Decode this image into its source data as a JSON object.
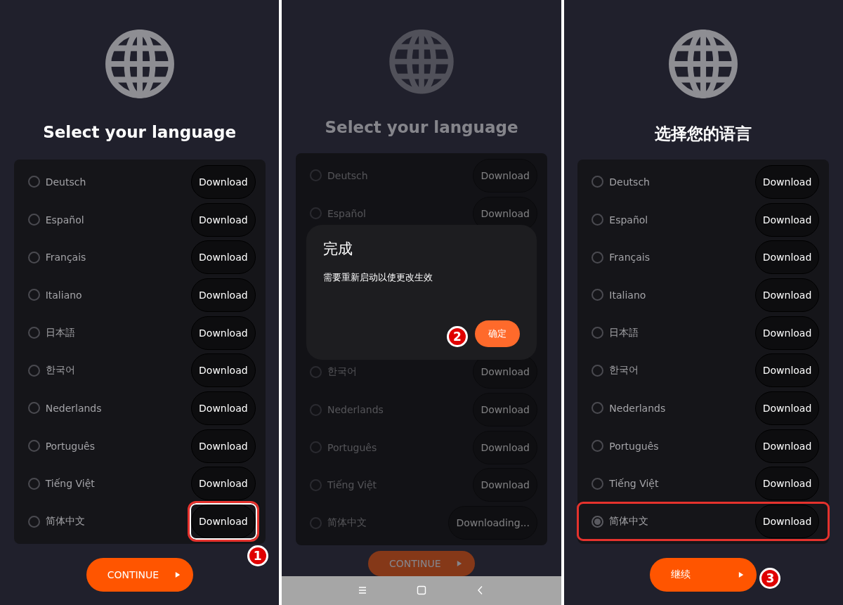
{
  "panels": [
    {
      "title": "Select your language",
      "dimmed": false,
      "nav_bar": false,
      "continue": {
        "label": "CONTINUE"
      },
      "items": [
        {
          "kind": "language",
          "name": "Deutsch",
          "selected": false,
          "button": "Download",
          "row_highlighted": false,
          "button_highlighted": false
        },
        {
          "kind": "language",
          "name": "Español",
          "selected": false,
          "button": "Download",
          "row_highlighted": false,
          "button_highlighted": false
        },
        {
          "kind": "language",
          "name": "Français",
          "selected": false,
          "button": "Download",
          "row_highlighted": false,
          "button_highlighted": false
        },
        {
          "kind": "language",
          "name": "Italiano",
          "selected": false,
          "button": "Download",
          "row_highlighted": false,
          "button_highlighted": false
        },
        {
          "kind": "language",
          "name": "日本語",
          "selected": false,
          "button": "Download",
          "row_highlighted": false,
          "button_highlighted": false
        },
        {
          "kind": "language",
          "name": "한국어",
          "selected": false,
          "button": "Download",
          "row_highlighted": false,
          "button_highlighted": false
        },
        {
          "kind": "language",
          "name": "Nederlands",
          "selected": false,
          "button": "Download",
          "row_highlighted": false,
          "button_highlighted": false
        },
        {
          "kind": "language",
          "name": "Português",
          "selected": false,
          "button": "Download",
          "row_highlighted": false,
          "button_highlighted": false
        },
        {
          "kind": "language",
          "name": "Tiếng Việt",
          "selected": false,
          "button": "Download",
          "row_highlighted": false,
          "button_highlighted": false
        },
        {
          "kind": "language",
          "name": "简体中文",
          "selected": false,
          "button": "Download",
          "row_highlighted": false,
          "button_highlighted": true,
          "step": "1"
        }
      ]
    },
    {
      "title": "Select your language",
      "dimmed": true,
      "nav_bar": true,
      "continue": {
        "label": "CONTINUE"
      },
      "items": [
        {
          "kind": "language",
          "name": "Deutsch",
          "selected": false,
          "button": "Download",
          "row_highlighted": false,
          "button_highlighted": false
        },
        {
          "kind": "language",
          "name": "Español",
          "selected": false,
          "button": "Download",
          "row_highlighted": false,
          "button_highlighted": false
        },
        {
          "kind": "dialog",
          "title": "完成",
          "message": "需要重新启动以使更改生效",
          "confirm": "确定",
          "step": "2"
        },
        {
          "kind": "language",
          "name": "한국어",
          "selected": false,
          "button": "Download",
          "row_highlighted": false,
          "button_highlighted": false
        },
        {
          "kind": "language",
          "name": "Nederlands",
          "selected": false,
          "button": "Download",
          "row_highlighted": false,
          "button_highlighted": false
        },
        {
          "kind": "language",
          "name": "Português",
          "selected": false,
          "button": "Download",
          "row_highlighted": false,
          "button_highlighted": false
        },
        {
          "kind": "language",
          "name": "Tiếng Việt",
          "selected": false,
          "button": "Download",
          "row_highlighted": false,
          "button_highlighted": false
        },
        {
          "kind": "language",
          "name": "简体中文",
          "selected": false,
          "button": "Downloading...",
          "row_highlighted": false,
          "button_highlighted": false
        }
      ]
    },
    {
      "title": "选择您的语言",
      "dimmed": false,
      "nav_bar": false,
      "continue": {
        "label": "继续",
        "step": "3"
      },
      "items": [
        {
          "kind": "language",
          "name": "Deutsch",
          "selected": false,
          "button": "Download",
          "row_highlighted": false,
          "button_highlighted": false
        },
        {
          "kind": "language",
          "name": "Español",
          "selected": false,
          "button": "Download",
          "row_highlighted": false,
          "button_highlighted": false
        },
        {
          "kind": "language",
          "name": "Français",
          "selected": false,
          "button": "Download",
          "row_highlighted": false,
          "button_highlighted": false
        },
        {
          "kind": "language",
          "name": "Italiano",
          "selected": false,
          "button": "Download",
          "row_highlighted": false,
          "button_highlighted": false
        },
        {
          "kind": "language",
          "name": "日本語",
          "selected": false,
          "button": "Download",
          "row_highlighted": false,
          "button_highlighted": false
        },
        {
          "kind": "language",
          "name": "한국어",
          "selected": false,
          "button": "Download",
          "row_highlighted": false,
          "button_highlighted": false
        },
        {
          "kind": "language",
          "name": "Nederlands",
          "selected": false,
          "button": "Download",
          "row_highlighted": false,
          "button_highlighted": false
        },
        {
          "kind": "language",
          "name": "Português",
          "selected": false,
          "button": "Download",
          "row_highlighted": false,
          "button_highlighted": false
        },
        {
          "kind": "language",
          "name": "Tiếng Việt",
          "selected": false,
          "button": "Download",
          "row_highlighted": false,
          "button_highlighted": false
        },
        {
          "kind": "language",
          "name": "简体中文",
          "selected": true,
          "button": "Download",
          "row_highlighted": true,
          "button_highlighted": false
        }
      ]
    }
  ]
}
